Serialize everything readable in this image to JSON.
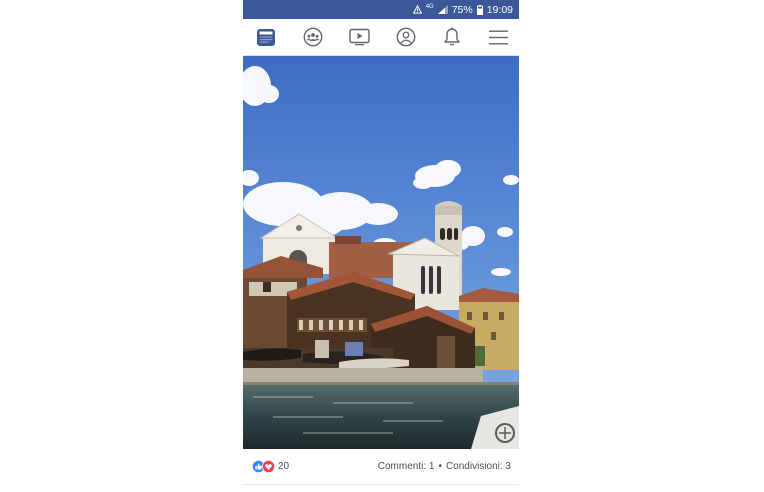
{
  "status_bar": {
    "network": "4G",
    "battery": "75%",
    "time": "19:09"
  },
  "nav": {
    "items": [
      {
        "icon": "news-feed-icon",
        "active": true
      },
      {
        "icon": "groups-icon",
        "active": false
      },
      {
        "icon": "watch-icon",
        "active": false
      },
      {
        "icon": "profile-icon",
        "active": false
      },
      {
        "icon": "notifications-bell-icon",
        "active": false
      },
      {
        "icon": "menu-icon",
        "active": false
      }
    ]
  },
  "post": {
    "photo": {
      "subject": "Venice canal boatyard with church bell tower"
    },
    "reactions": {
      "count": "20",
      "types": [
        "like",
        "love"
      ]
    },
    "comments": "Commenti: 1",
    "separator": "•",
    "shares": "Condivisioni: 3"
  },
  "colors": {
    "brand": "#3b5998",
    "accent": "#1877f2",
    "like": "#2d88ff",
    "love": "#f33e58",
    "icon_gray": "#606770"
  }
}
